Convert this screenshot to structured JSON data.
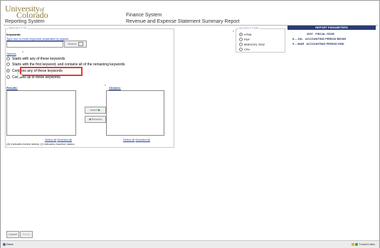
{
  "header": {
    "logo_main": "University",
    "logo_of": "of",
    "logo_sub": "Colorado",
    "system": "Reporting System",
    "finance": "Finance System",
    "report_title": "Revenue and Expense Statement Summary Report"
  },
  "specify": {
    "legend": "SPECIFY FYE",
    "keywords_label": "Keywords:",
    "keywords_hint": "Type one or more keywords separated by spaces",
    "search_label": "Search",
    "options_label": "Options",
    "options": [
      "Starts with any of these keywords",
      "Starts with the first keyword, and contains all of the remaining keywords",
      "Contains any of these keywords",
      "Contains all of these keywords"
    ],
    "selected_option_index": 2,
    "results_label": "Results:",
    "choices_label": "Choices:",
    "insert_label": "Insert",
    "remove_label": "Remove",
    "select_all": "Select all",
    "deselect_all": "Deselect all",
    "status_note": "(A) indicates Active status. (I) indicates Inactive status."
  },
  "output": {
    "legend": "OUTPUT TYPE",
    "options": [
      "HTML",
      "PDF",
      "MSEXCEL 2002",
      "CSV"
    ],
    "selected_index": 0
  },
  "params": {
    "title": "REPORT PARAMETERS",
    "rows": [
      {
        "value": "2007",
        "label": "FISCAL YEAR"
      },
      {
        "value": "8 -- JUL",
        "label": "ACCOUNTING PERIOD BEGIN"
      },
      {
        "value": "9 -- MAR",
        "label": "ACCOUNTING PERIOD END"
      }
    ]
  },
  "footer": {
    "cancel": "Cancel",
    "finish": "Finish"
  },
  "statusbar": {
    "left": "Done",
    "right": "Trusted sites"
  }
}
